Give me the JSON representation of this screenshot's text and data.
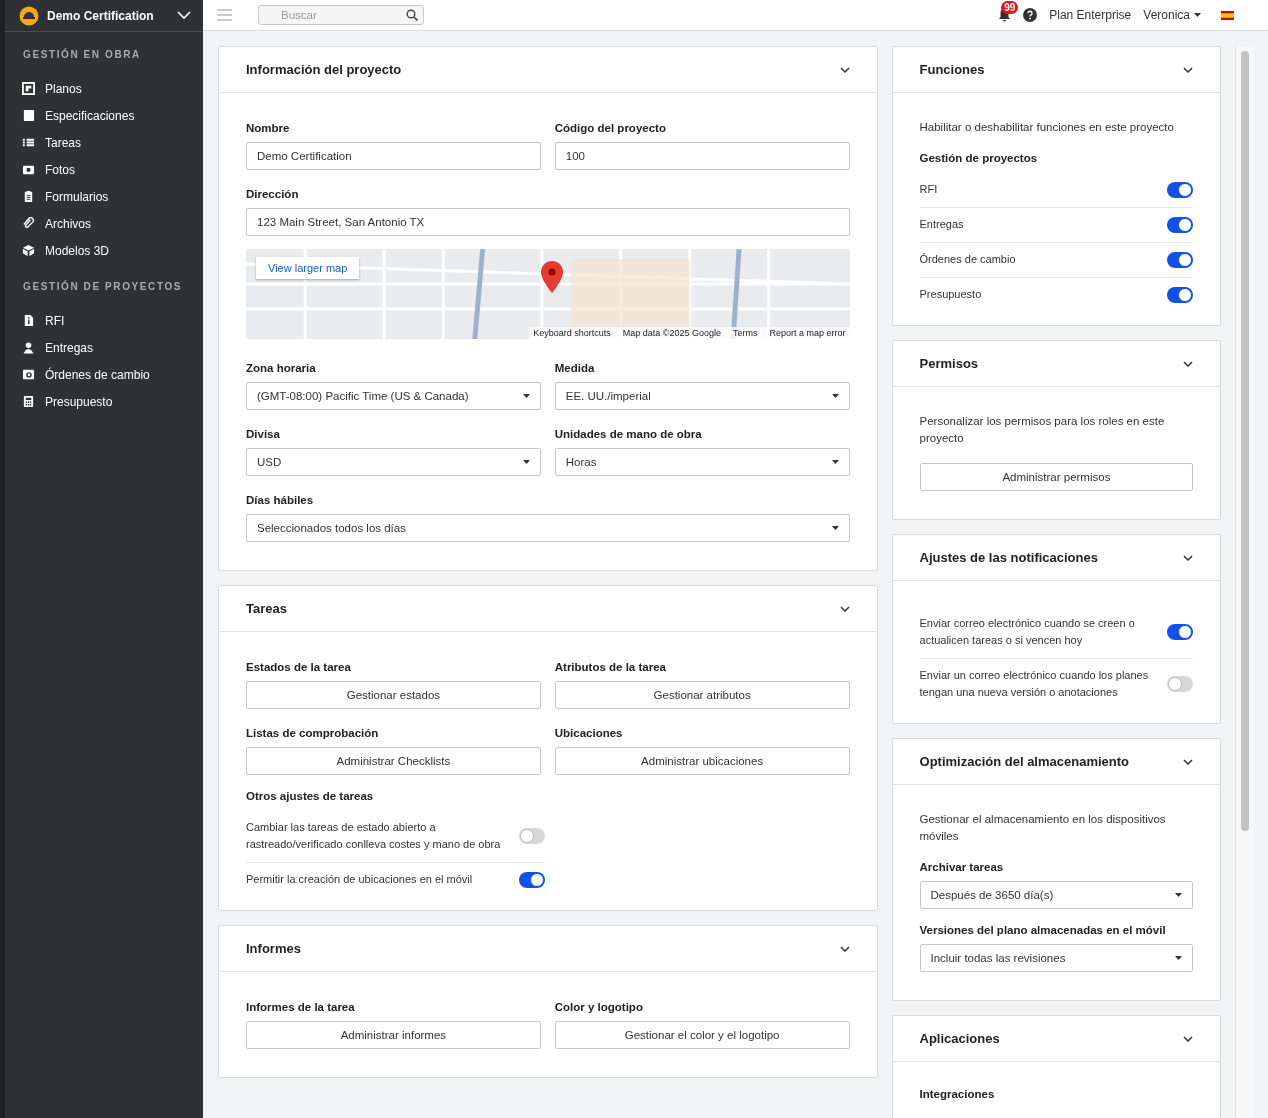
{
  "sidebar": {
    "project": "Demo Certification",
    "sections": [
      {
        "title": "GESTIÓN EN OBRA",
        "items": [
          {
            "label": "Planos"
          },
          {
            "label": "Especificaciones"
          },
          {
            "label": "Tareas"
          },
          {
            "label": "Fotos"
          },
          {
            "label": "Formularios"
          },
          {
            "label": "Archivos"
          },
          {
            "label": "Modelos 3D"
          }
        ]
      },
      {
        "title": "GESTIÓN DE PROYECTOS",
        "items": [
          {
            "label": "RFI"
          },
          {
            "label": "Entregas"
          },
          {
            "label": "Órdenes de cambio"
          },
          {
            "label": "Presupuesto"
          }
        ]
      }
    ]
  },
  "topbar": {
    "search": {
      "placeholder": "Buscar"
    },
    "notifications": "99",
    "plan": "Plan Enterprise",
    "user": "Veronica"
  },
  "columns": [
    [
      {
        "title": "Información del proyecto",
        "blocks": [
          {
            "kind": "pair",
            "fields": [
              {
                "label": "Nombre",
                "control": {
                  "kind": "input",
                  "value": "Demo Certification"
                }
              },
              {
                "label": "Código del proyecto",
                "control": {
                  "kind": "input",
                  "value": "100"
                }
              }
            ]
          },
          {
            "kind": "field",
            "label": "Dirección",
            "control": {
              "kind": "input",
              "value": "123 Main Street, San Antonio TX"
            }
          },
          {
            "kind": "map",
            "link": "View larger map",
            "footer": [
              "Keyboard shortcuts",
              "Map data ©2025 Google",
              "Terms",
              "Report a map error"
            ]
          },
          {
            "kind": "pair",
            "fields": [
              {
                "label": "Zona horaria",
                "control": {
                  "kind": "select",
                  "value": "(GMT-08:00) Pacific Time (US & Canada)"
                }
              },
              {
                "label": "Medida",
                "control": {
                  "kind": "select",
                  "value": "EE. UU./imperial"
                }
              }
            ]
          },
          {
            "kind": "pair",
            "fields": [
              {
                "label": "Divisa",
                "control": {
                  "kind": "select",
                  "value": "USD"
                }
              },
              {
                "label": "Unidades de mano de obra",
                "control": {
                  "kind": "select",
                  "value": "Horas"
                }
              }
            ]
          },
          {
            "kind": "field",
            "label": "Días hábiles",
            "control": {
              "kind": "select",
              "value": "Seleccionados todos los días"
            }
          }
        ]
      },
      {
        "title": "Tareas",
        "blocks": [
          {
            "kind": "pair",
            "fields": [
              {
                "label": "Estados de la tarea",
                "control": {
                  "kind": "button",
                  "value": "Gestionar estados"
                }
              },
              {
                "label": "Atributos de la tarea",
                "control": {
                  "kind": "button",
                  "value": "Gestionar atributos"
                }
              }
            ]
          },
          {
            "kind": "pair",
            "fields": [
              {
                "label": "Listas de comprobación",
                "control": {
                  "kind": "button",
                  "value": "Administrar Checklists"
                }
              },
              {
                "label": "Ubicaciones",
                "control": {
                  "kind": "button",
                  "value": "Administrar ubicaciones"
                }
              }
            ]
          },
          {
            "kind": "subheading",
            "text": "Otros ajustes de tareas"
          },
          {
            "kind": "toggle",
            "half": true,
            "label": "Cambiar las tareas de estado abierto a rastreado/verificado conlleva costes y mano de obra",
            "on": false
          },
          {
            "kind": "toggle",
            "half": true,
            "label": "Permitir la creación de ubicaciones en el móvil",
            "on": true
          }
        ]
      },
      {
        "title": "Informes",
        "blocks": [
          {
            "kind": "pair",
            "fields": [
              {
                "label": "Informes de la tarea",
                "control": {
                  "kind": "button",
                  "value": "Administrar informes"
                }
              },
              {
                "label": "Color y logotipo",
                "control": {
                  "kind": "button",
                  "value": "Gestionar el color y el logotipo"
                }
              }
            ]
          }
        ]
      }
    ],
    [
      {
        "title": "Funciones",
        "blocks": [
          {
            "kind": "text",
            "text": "Habilitar o deshabilitar funciones en este proyecto"
          },
          {
            "kind": "subheading",
            "text": "Gestión de proyectos"
          },
          {
            "kind": "toggle",
            "label": "RFI",
            "on": true
          },
          {
            "kind": "toggle",
            "label": "Entregas",
            "on": true
          },
          {
            "kind": "toggle",
            "label": "Órdenes de cambio",
            "on": true
          },
          {
            "kind": "toggle",
            "label": "Presupuesto",
            "on": true
          }
        ]
      },
      {
        "title": "Permisos",
        "blocks": [
          {
            "kind": "text",
            "text": "Personalizar los permisos para los roles en este proyecto"
          },
          {
            "kind": "button",
            "value": "Administrar permisos"
          }
        ]
      },
      {
        "title": "Ajustes de las notificaciones",
        "blocks": [
          {
            "kind": "toggle",
            "label": "Enviar correo electrónico cuando se creen o actualicen tareas o si vencen hoy",
            "on": true
          },
          {
            "kind": "toggle",
            "label": "Enviar un correo electrónico cuando los planes tengan una nueva versión o anotaciones",
            "on": false
          }
        ]
      },
      {
        "title": "Optimización del almacenamiento",
        "blocks": [
          {
            "kind": "text",
            "text": "Gestionar el almacenamiento en los dispositivos móviles"
          },
          {
            "kind": "field",
            "label": "Archivar tareas",
            "control": {
              "kind": "select",
              "value": "Después de 3650 día(s)"
            }
          },
          {
            "kind": "field",
            "label": "Versiones del plano almacenadas en el móvil",
            "control": {
              "kind": "select",
              "value": "Incluir todas las revisiones"
            }
          }
        ]
      },
      {
        "title": "Aplicaciones",
        "blocks": [
          {
            "kind": "subheading",
            "text": "Integraciones"
          }
        ]
      }
    ]
  ]
}
